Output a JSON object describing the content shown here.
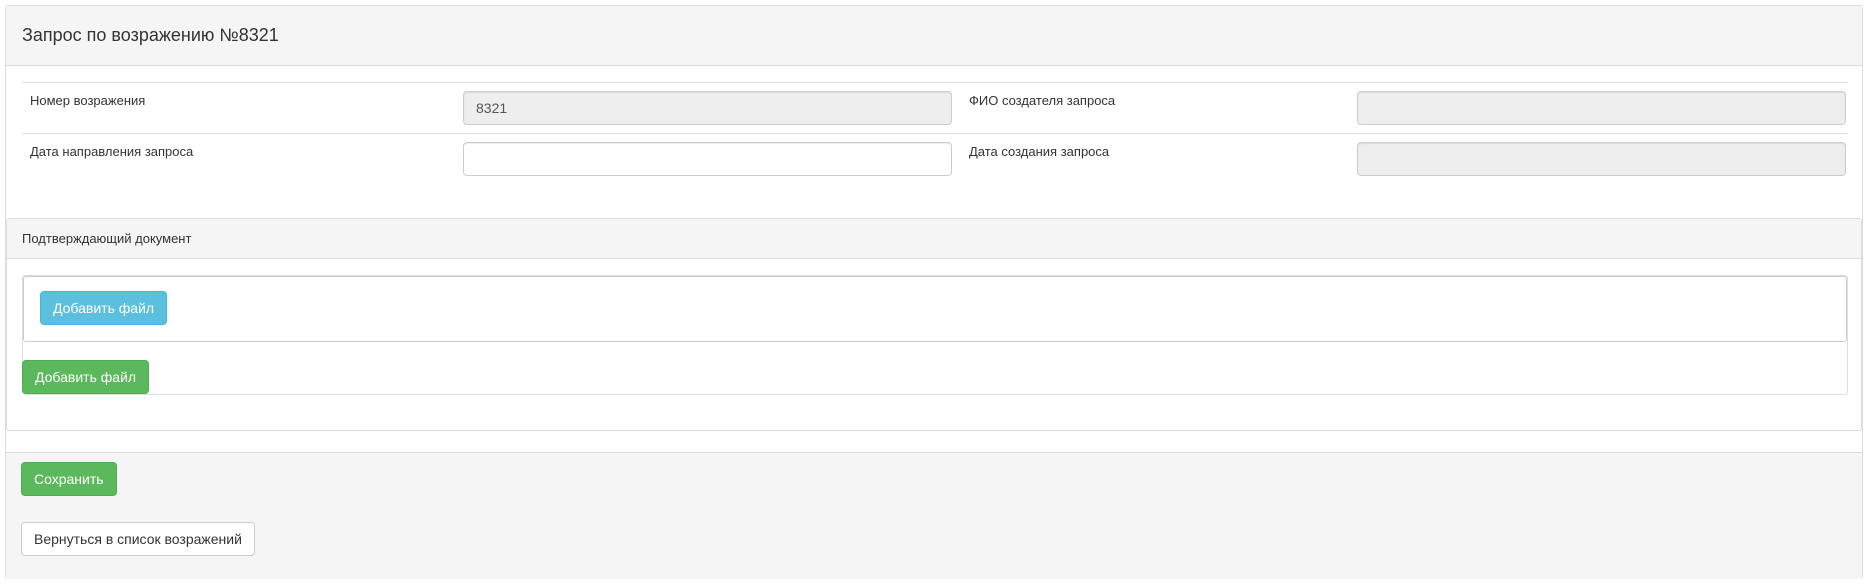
{
  "header": {
    "title": "Запрос по возражению №8321"
  },
  "form": {
    "objection_number_label": "Номер возражения",
    "objection_number_value": "8321",
    "creator_name_label": "ФИО создателя запроса",
    "creator_name_value": "",
    "send_date_label": "Дата направления запроса",
    "send_date_value": "",
    "created_date_label": "Дата создания запроса",
    "created_date_value": ""
  },
  "document_section": {
    "title": "Подтверждающий документ",
    "add_file_info_label": "Добавить файл",
    "add_file_success_label": "Добавить файл"
  },
  "footer": {
    "save_label": "Сохранить",
    "back_label": "Вернуться в список возражений"
  },
  "colors": {
    "info": "#5bc0de",
    "success": "#5cb85c",
    "panel_bg": "#f5f5f5",
    "border": "#dddddd"
  }
}
